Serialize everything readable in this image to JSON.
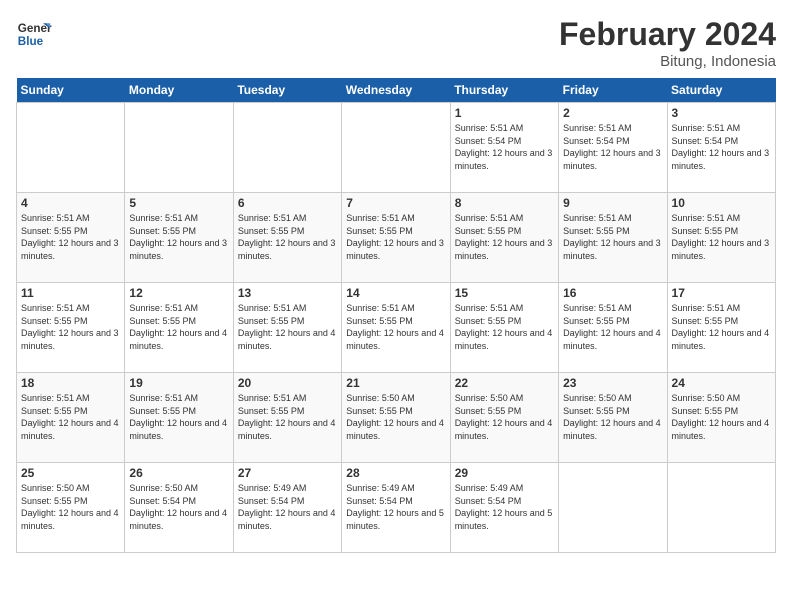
{
  "header": {
    "logo_line1": "General",
    "logo_line2": "Blue",
    "month_title": "February 2024",
    "location": "Bitung, Indonesia"
  },
  "days_of_week": [
    "Sunday",
    "Monday",
    "Tuesday",
    "Wednesday",
    "Thursday",
    "Friday",
    "Saturday"
  ],
  "weeks": [
    [
      {
        "day": null
      },
      {
        "day": null
      },
      {
        "day": null
      },
      {
        "day": null
      },
      {
        "day": "1",
        "sunrise": "Sunrise: 5:51 AM",
        "sunset": "Sunset: 5:54 PM",
        "daylight": "Daylight: 12 hours and 3 minutes."
      },
      {
        "day": "2",
        "sunrise": "Sunrise: 5:51 AM",
        "sunset": "Sunset: 5:54 PM",
        "daylight": "Daylight: 12 hours and 3 minutes."
      },
      {
        "day": "3",
        "sunrise": "Sunrise: 5:51 AM",
        "sunset": "Sunset: 5:54 PM",
        "daylight": "Daylight: 12 hours and 3 minutes."
      }
    ],
    [
      {
        "day": "4",
        "sunrise": "Sunrise: 5:51 AM",
        "sunset": "Sunset: 5:55 PM",
        "daylight": "Daylight: 12 hours and 3 minutes."
      },
      {
        "day": "5",
        "sunrise": "Sunrise: 5:51 AM",
        "sunset": "Sunset: 5:55 PM",
        "daylight": "Daylight: 12 hours and 3 minutes."
      },
      {
        "day": "6",
        "sunrise": "Sunrise: 5:51 AM",
        "sunset": "Sunset: 5:55 PM",
        "daylight": "Daylight: 12 hours and 3 minutes."
      },
      {
        "day": "7",
        "sunrise": "Sunrise: 5:51 AM",
        "sunset": "Sunset: 5:55 PM",
        "daylight": "Daylight: 12 hours and 3 minutes."
      },
      {
        "day": "8",
        "sunrise": "Sunrise: 5:51 AM",
        "sunset": "Sunset: 5:55 PM",
        "daylight": "Daylight: 12 hours and 3 minutes."
      },
      {
        "day": "9",
        "sunrise": "Sunrise: 5:51 AM",
        "sunset": "Sunset: 5:55 PM",
        "daylight": "Daylight: 12 hours and 3 minutes."
      },
      {
        "day": "10",
        "sunrise": "Sunrise: 5:51 AM",
        "sunset": "Sunset: 5:55 PM",
        "daylight": "Daylight: 12 hours and 3 minutes."
      }
    ],
    [
      {
        "day": "11",
        "sunrise": "Sunrise: 5:51 AM",
        "sunset": "Sunset: 5:55 PM",
        "daylight": "Daylight: 12 hours and 3 minutes."
      },
      {
        "day": "12",
        "sunrise": "Sunrise: 5:51 AM",
        "sunset": "Sunset: 5:55 PM",
        "daylight": "Daylight: 12 hours and 4 minutes."
      },
      {
        "day": "13",
        "sunrise": "Sunrise: 5:51 AM",
        "sunset": "Sunset: 5:55 PM",
        "daylight": "Daylight: 12 hours and 4 minutes."
      },
      {
        "day": "14",
        "sunrise": "Sunrise: 5:51 AM",
        "sunset": "Sunset: 5:55 PM",
        "daylight": "Daylight: 12 hours and 4 minutes."
      },
      {
        "day": "15",
        "sunrise": "Sunrise: 5:51 AM",
        "sunset": "Sunset: 5:55 PM",
        "daylight": "Daylight: 12 hours and 4 minutes."
      },
      {
        "day": "16",
        "sunrise": "Sunrise: 5:51 AM",
        "sunset": "Sunset: 5:55 PM",
        "daylight": "Daylight: 12 hours and 4 minutes."
      },
      {
        "day": "17",
        "sunrise": "Sunrise: 5:51 AM",
        "sunset": "Sunset: 5:55 PM",
        "daylight": "Daylight: 12 hours and 4 minutes."
      }
    ],
    [
      {
        "day": "18",
        "sunrise": "Sunrise: 5:51 AM",
        "sunset": "Sunset: 5:55 PM",
        "daylight": "Daylight: 12 hours and 4 minutes."
      },
      {
        "day": "19",
        "sunrise": "Sunrise: 5:51 AM",
        "sunset": "Sunset: 5:55 PM",
        "daylight": "Daylight: 12 hours and 4 minutes."
      },
      {
        "day": "20",
        "sunrise": "Sunrise: 5:51 AM",
        "sunset": "Sunset: 5:55 PM",
        "daylight": "Daylight: 12 hours and 4 minutes."
      },
      {
        "day": "21",
        "sunrise": "Sunrise: 5:50 AM",
        "sunset": "Sunset: 5:55 PM",
        "daylight": "Daylight: 12 hours and 4 minutes."
      },
      {
        "day": "22",
        "sunrise": "Sunrise: 5:50 AM",
        "sunset": "Sunset: 5:55 PM",
        "daylight": "Daylight: 12 hours and 4 minutes."
      },
      {
        "day": "23",
        "sunrise": "Sunrise: 5:50 AM",
        "sunset": "Sunset: 5:55 PM",
        "daylight": "Daylight: 12 hours and 4 minutes."
      },
      {
        "day": "24",
        "sunrise": "Sunrise: 5:50 AM",
        "sunset": "Sunset: 5:55 PM",
        "daylight": "Daylight: 12 hours and 4 minutes."
      }
    ],
    [
      {
        "day": "25",
        "sunrise": "Sunrise: 5:50 AM",
        "sunset": "Sunset: 5:55 PM",
        "daylight": "Daylight: 12 hours and 4 minutes."
      },
      {
        "day": "26",
        "sunrise": "Sunrise: 5:50 AM",
        "sunset": "Sunset: 5:54 PM",
        "daylight": "Daylight: 12 hours and 4 minutes."
      },
      {
        "day": "27",
        "sunrise": "Sunrise: 5:49 AM",
        "sunset": "Sunset: 5:54 PM",
        "daylight": "Daylight: 12 hours and 4 minutes."
      },
      {
        "day": "28",
        "sunrise": "Sunrise: 5:49 AM",
        "sunset": "Sunset: 5:54 PM",
        "daylight": "Daylight: 12 hours and 5 minutes."
      },
      {
        "day": "29",
        "sunrise": "Sunrise: 5:49 AM",
        "sunset": "Sunset: 5:54 PM",
        "daylight": "Daylight: 12 hours and 5 minutes."
      },
      {
        "day": null
      },
      {
        "day": null
      }
    ]
  ]
}
